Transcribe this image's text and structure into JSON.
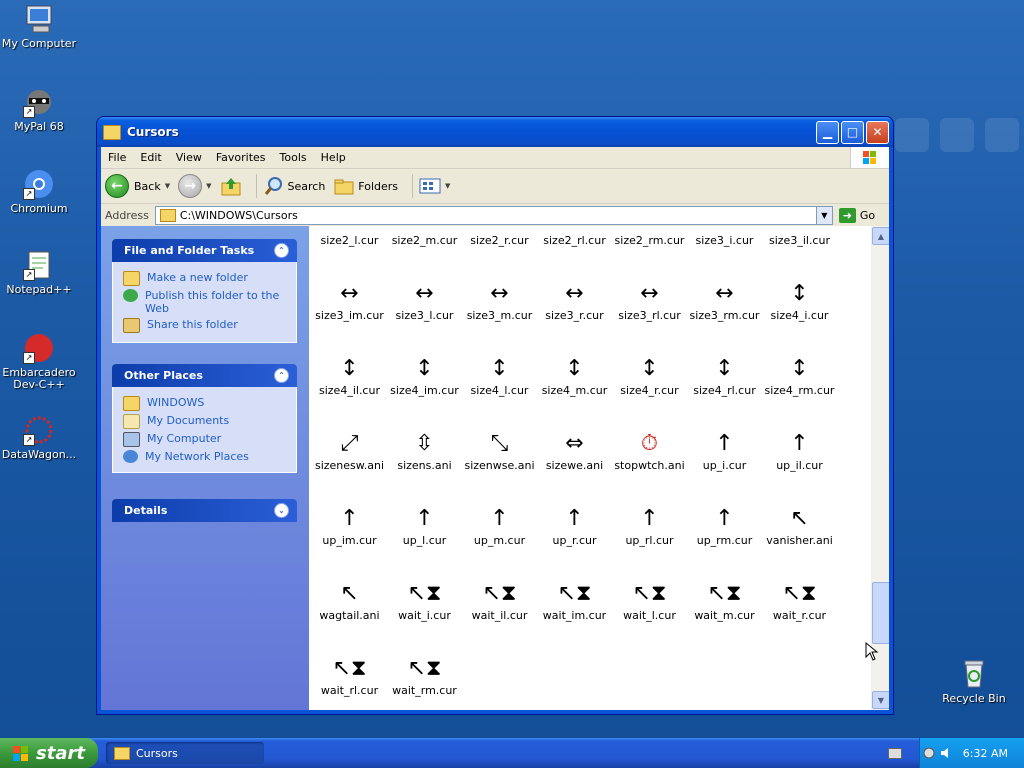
{
  "desktop": {
    "icons": [
      {
        "label": "My Computer"
      },
      {
        "label": "MyPal 68"
      },
      {
        "label": "Chromium"
      },
      {
        "label": "Notepad++"
      },
      {
        "label": "Embarcadero Dev-C++"
      },
      {
        "label": "DataWagon..."
      },
      {
        "label": "Recycle Bin"
      }
    ]
  },
  "window": {
    "title": "Cursors",
    "menu": [
      "File",
      "Edit",
      "View",
      "Favorites",
      "Tools",
      "Help"
    ],
    "toolbar": {
      "back": "Back",
      "search": "Search",
      "folders": "Folders"
    },
    "address": {
      "label": "Address",
      "value": "C:\\WINDOWS\\Cursors",
      "go": "Go"
    }
  },
  "left_panel": {
    "tasks": {
      "title": "File and Folder Tasks",
      "items": [
        "Make a new folder",
        "Publish this folder to the Web",
        "Share this folder"
      ]
    },
    "places": {
      "title": "Other Places",
      "items": [
        "WINDOWS",
        "My Documents",
        "My Computer",
        "My Network Places"
      ]
    },
    "details": {
      "title": "Details"
    }
  },
  "files": [
    {
      "name": "size2_l.cur",
      "icon": "diagonal-arrow"
    },
    {
      "name": "size2_m.cur",
      "icon": "diagonal-arrow"
    },
    {
      "name": "size2_r.cur",
      "icon": "diagonal-arrow"
    },
    {
      "name": "size2_rl.cur",
      "icon": "diagonal-arrow"
    },
    {
      "name": "size2_rm.cur",
      "icon": "diagonal-arrow"
    },
    {
      "name": "size3_i.cur",
      "icon": "horizontal-arrow"
    },
    {
      "name": "size3_il.cur",
      "icon": "horizontal-arrow"
    },
    {
      "name": "size3_im.cur",
      "icon": "horizontal-arrow"
    },
    {
      "name": "size3_l.cur",
      "icon": "horizontal-arrow"
    },
    {
      "name": "size3_m.cur",
      "icon": "horizontal-arrow"
    },
    {
      "name": "size3_r.cur",
      "icon": "horizontal-arrow"
    },
    {
      "name": "size3_rl.cur",
      "icon": "horizontal-arrow"
    },
    {
      "name": "size3_rm.cur",
      "icon": "horizontal-arrow"
    },
    {
      "name": "size4_i.cur",
      "icon": "vertical-arrow"
    },
    {
      "name": "size4_il.cur",
      "icon": "vertical-arrow"
    },
    {
      "name": "size4_im.cur",
      "icon": "vertical-arrow"
    },
    {
      "name": "size4_l.cur",
      "icon": "vertical-arrow"
    },
    {
      "name": "size4_m.cur",
      "icon": "vertical-arrow"
    },
    {
      "name": "size4_r.cur",
      "icon": "vertical-arrow"
    },
    {
      "name": "size4_rl.cur",
      "icon": "vertical-arrow"
    },
    {
      "name": "size4_rm.cur",
      "icon": "vertical-arrow"
    },
    {
      "name": "sizenesw.ani",
      "icon": "nesw-arrow"
    },
    {
      "name": "sizens.ani",
      "icon": "ns-arrow"
    },
    {
      "name": "sizenwse.ani",
      "icon": "nwse-arrow"
    },
    {
      "name": "sizewe.ani",
      "icon": "we-arrow"
    },
    {
      "name": "stopwtch.ani",
      "icon": "stopwatch"
    },
    {
      "name": "up_i.cur",
      "icon": "up-arrow"
    },
    {
      "name": "up_il.cur",
      "icon": "up-arrow"
    },
    {
      "name": "up_im.cur",
      "icon": "up-arrow"
    },
    {
      "name": "up_l.cur",
      "icon": "up-arrow"
    },
    {
      "name": "up_m.cur",
      "icon": "up-arrow"
    },
    {
      "name": "up_r.cur",
      "icon": "up-arrow"
    },
    {
      "name": "up_rl.cur",
      "icon": "up-arrow"
    },
    {
      "name": "up_rm.cur",
      "icon": "up-arrow"
    },
    {
      "name": "vanisher.ani",
      "icon": "pointer"
    },
    {
      "name": "wagtail.ani",
      "icon": "pointer"
    },
    {
      "name": "wait_i.cur",
      "icon": "hourglass-pointer"
    },
    {
      "name": "wait_il.cur",
      "icon": "hourglass-pointer"
    },
    {
      "name": "wait_im.cur",
      "icon": "hourglass-pointer"
    },
    {
      "name": "wait_l.cur",
      "icon": "hourglass-pointer"
    },
    {
      "name": "wait_m.cur",
      "icon": "hourglass-pointer"
    },
    {
      "name": "wait_r.cur",
      "icon": "hourglass-pointer"
    },
    {
      "name": "wait_rl.cur",
      "icon": "hourglass-pointer"
    },
    {
      "name": "wait_rm.cur",
      "icon": "hourglass-pointer"
    }
  ],
  "taskbar": {
    "start": "start",
    "task": "Cursors",
    "clock": "6:32 AM"
  }
}
